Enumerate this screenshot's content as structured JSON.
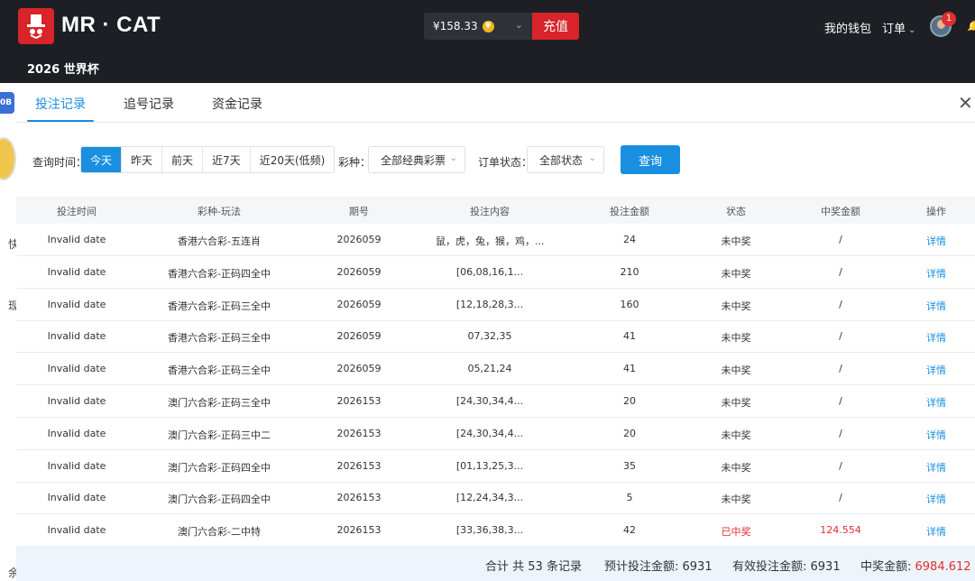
{
  "header": {
    "brand": "MR · CAT",
    "cup_link": "2026 世界杯",
    "balance": "¥158.33",
    "coin_symbol": "¥",
    "recharge_label": "充值",
    "wallet_label": "我的钱包",
    "orders_label": "订单",
    "notification_count": "1"
  },
  "background": {
    "side_badge": "0B",
    "mark_1": "快",
    "mark_2": "现",
    "mark_3": "余"
  },
  "modal": {
    "tabs": [
      {
        "label": "投注记录",
        "active": true
      },
      {
        "label": "追号记录",
        "active": false
      },
      {
        "label": "资金记录",
        "active": false
      }
    ],
    "filters": {
      "time_label": "查询时间：",
      "days": [
        "今天",
        "昨天",
        "前天",
        "近7天",
        "近20天(低频)"
      ],
      "lottery_label": "彩种：",
      "lottery_value": "全部经典彩票",
      "status_label": "订单状态：",
      "status_value": "全部状态",
      "query_label": "查询"
    },
    "columns": [
      "投注时间",
      "彩种-玩法",
      "期号",
      "投注内容",
      "投注金额",
      "状态",
      "中奖金额",
      "操作"
    ],
    "rows": [
      {
        "time": "Invalid date",
        "game": "香港六合彩-五连肖",
        "issue": "2026059",
        "content": "鼠，虎，兔，猴，鸡，...",
        "amount": "24",
        "status": "未中奖",
        "prize": "/",
        "action": "详情",
        "won": false
      },
      {
        "time": "Invalid date",
        "game": "香港六合彩-正码四全中",
        "issue": "2026059",
        "content": "[06,08,16,1...",
        "amount": "210",
        "status": "未中奖",
        "prize": "/",
        "action": "详情",
        "won": false
      },
      {
        "time": "Invalid date",
        "game": "香港六合彩-正码三全中",
        "issue": "2026059",
        "content": "[12,18,28,3...",
        "amount": "160",
        "status": "未中奖",
        "prize": "/",
        "action": "详情",
        "won": false
      },
      {
        "time": "Invalid date",
        "game": "香港六合彩-正码三全中",
        "issue": "2026059",
        "content": "07,32,35",
        "amount": "41",
        "status": "未中奖",
        "prize": "/",
        "action": "详情",
        "won": false
      },
      {
        "time": "Invalid date",
        "game": "香港六合彩-正码三全中",
        "issue": "2026059",
        "content": "05,21,24",
        "amount": "41",
        "status": "未中奖",
        "prize": "/",
        "action": "详情",
        "won": false
      },
      {
        "time": "Invalid date",
        "game": "澳门六合彩-正码三全中",
        "issue": "2026153",
        "content": "[24,30,34,4...",
        "amount": "20",
        "status": "未中奖",
        "prize": "/",
        "action": "详情",
        "won": false
      },
      {
        "time": "Invalid date",
        "game": "澳门六合彩-正码三中二",
        "issue": "2026153",
        "content": "[24,30,34,4...",
        "amount": "20",
        "status": "未中奖",
        "prize": "/",
        "action": "详情",
        "won": false
      },
      {
        "time": "Invalid date",
        "game": "澳门六合彩-正码四全中",
        "issue": "2026153",
        "content": "[01,13,25,3...",
        "amount": "35",
        "status": "未中奖",
        "prize": "/",
        "action": "详情",
        "won": false
      },
      {
        "time": "Invalid date",
        "game": "澳门六合彩-正码四全中",
        "issue": "2026153",
        "content": "[12,24,34,3...",
        "amount": "5",
        "status": "未中奖",
        "prize": "/",
        "action": "详情",
        "won": false
      },
      {
        "time": "Invalid date",
        "game": "澳门六合彩-二中特",
        "issue": "2026153",
        "content": "[33,36,38,3...",
        "amount": "42",
        "status": "已中奖",
        "prize": "124.554",
        "action": "详情",
        "won": true
      }
    ],
    "footer": {
      "total_records": "合计 共 53 条记录",
      "estimated_label": "预计投注金额: ",
      "estimated_value": "6931",
      "valid_label": "有效投注金额: ",
      "valid_value": "6931",
      "prize_label": "中奖金额: ",
      "prize_value": "6984.612"
    }
  },
  "colors": {
    "accent": "#1a8fe0",
    "brand_red": "#d8242a",
    "win_red": "#e02e2e",
    "header_bg": "#1d1f24"
  }
}
